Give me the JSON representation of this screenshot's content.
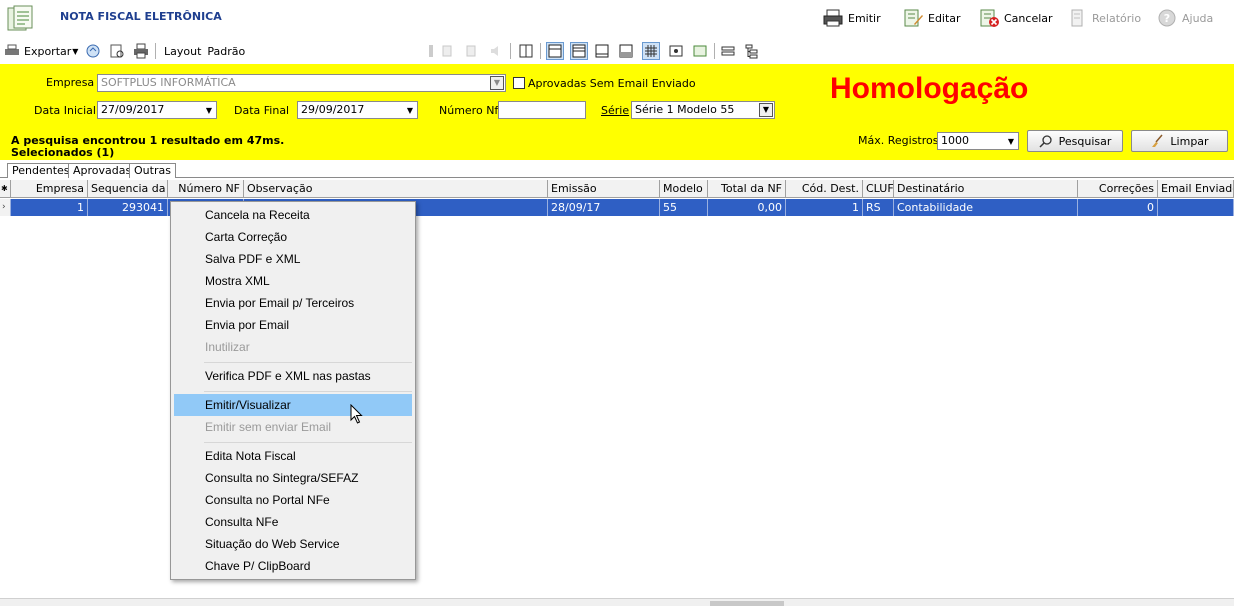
{
  "app": {
    "title": "NOTA FISCAL ELETRÔNICA"
  },
  "title_actions": [
    {
      "label": "Emitir",
      "icon": "printer-icon",
      "disabled": false
    },
    {
      "label": "Editar",
      "icon": "edit-document-icon",
      "disabled": false
    },
    {
      "label": "Cancelar",
      "icon": "cancel-document-icon",
      "disabled": false
    },
    {
      "label": "Relatório",
      "icon": "report-icon",
      "disabled": true
    },
    {
      "label": "Ajuda",
      "icon": "help-icon",
      "disabled": true
    }
  ],
  "toolbar": {
    "export_label": "Exportar",
    "layout_label": "Layout",
    "layout_value": "Padrão"
  },
  "filter": {
    "empresa_label": "Empresa",
    "empresa_value": "SOFTPLUS INFORMÁTICA",
    "aprovadas_label": "Aprovadas Sem Email Enviado",
    "data_inicial_label": "Data Inicial",
    "data_inicial_value": "27/09/2017",
    "data_final_label": "Data Final",
    "data_final_value": "29/09/2017",
    "numero_nf_label": "Número Nf",
    "numero_nf_value": "",
    "serie_label": "Série",
    "serie_value": "Série 1 Modelo 55",
    "environment_label": "Homologação",
    "result_text": "A pesquisa encontrou 1 resultado em 47ms.",
    "selected_text": "Selecionados (1)",
    "max_registros_label": "Máx. Registros",
    "max_registros_value": "1000",
    "pesquisar_label": "Pesquisar",
    "limpar_label": "Limpar"
  },
  "tabs": [
    "Pendentes",
    "Aprovadas",
    "Outras"
  ],
  "grid": {
    "columns": [
      "Empresa",
      "Sequencia da N",
      "Número NF",
      "Observação",
      "Emissão",
      "Modelo",
      "Total da NF",
      "Cód. Dest.",
      "CLUF",
      "Destinatário",
      "Correções",
      "Email Enviados"
    ],
    "rows": [
      {
        "empresa": "1",
        "sequencia": "293041",
        "numero_nf": "",
        "observacao": "",
        "emissao": "28/09/17",
        "modelo": "55",
        "total": "0,00",
        "cod_dest": "1",
        "cluf": "RS",
        "destinatario": "Contabilidade",
        "correcoes": "0",
        "email_enviados": ""
      }
    ]
  },
  "context_menu": {
    "items": [
      {
        "label": "Cancela na Receita",
        "disabled": false
      },
      {
        "label": "Carta Correção",
        "disabled": false
      },
      {
        "label": "Salva PDF e XML",
        "disabled": false
      },
      {
        "label": "Mostra XML",
        "disabled": false
      },
      {
        "label": "Envia por Email p/ Terceiros",
        "disabled": false
      },
      {
        "label": "Envia por Email",
        "disabled": false
      },
      {
        "label": "Inutilizar",
        "disabled": true
      },
      {
        "label": "Verifica PDF e XML nas pastas",
        "disabled": false
      },
      {
        "label": "Emitir/Visualizar",
        "disabled": false,
        "highlighted": true
      },
      {
        "label": "Emitir sem enviar Email",
        "disabled": true
      },
      {
        "label": "Edita Nota Fiscal",
        "disabled": false
      },
      {
        "label": "Consulta no Sintegra/SEFAZ",
        "disabled": false
      },
      {
        "label": "Consulta no Portal NFe",
        "disabled": false
      },
      {
        "label": "Consulta NFe",
        "disabled": false
      },
      {
        "label": "Situação do Web Service",
        "disabled": false
      },
      {
        "label": "Chave P/ ClipBoard",
        "disabled": false
      }
    ]
  }
}
